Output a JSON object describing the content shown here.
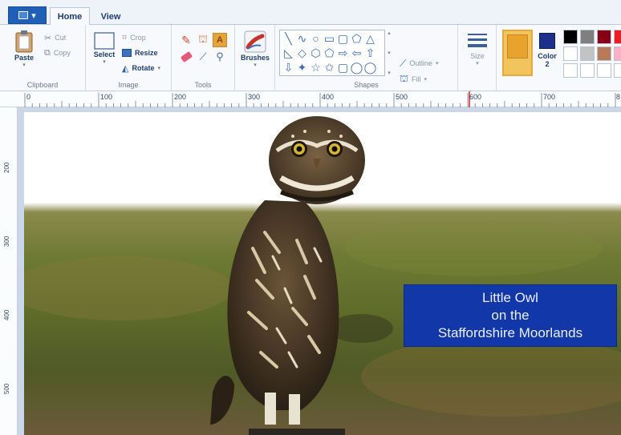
{
  "app_menu": {
    "icon": "paint-menu-icon"
  },
  "tabs": [
    {
      "label": "Home",
      "active": true
    },
    {
      "label": "View",
      "active": false
    }
  ],
  "ribbon": {
    "clipboard": {
      "group_label": "Clipboard",
      "paste_label": "Paste",
      "cut_label": "Cut",
      "copy_label": "Copy"
    },
    "image": {
      "group_label": "Image",
      "select_label": "Select",
      "crop_label": "Crop",
      "resize_label": "Resize",
      "rotate_label": "Rotate"
    },
    "tools": {
      "group_label": "Tools"
    },
    "brushes": {
      "label": "Brushes"
    },
    "shapes": {
      "group_label": "Shapes",
      "outline_label": "Outline",
      "fill_label": "Fill",
      "glyphs": [
        "╲",
        "∿",
        "○",
        "▭",
        "▢",
        "⬠",
        "△",
        "◺",
        "◇",
        "⬡",
        "⬠",
        "⇨",
        "⇦",
        "⇧",
        "⇩",
        "✦",
        "☆",
        "✩",
        "▢",
        "◯",
        "◯"
      ]
    },
    "size": {
      "label": "Size"
    },
    "color1": {
      "color": "#e8a32c"
    },
    "color2": {
      "label": "Color",
      "label_num": "2",
      "color": "#1c2f8a"
    },
    "palette": [
      "#000000",
      "#7f7f7f",
      "#880015",
      "#ed1c24",
      "#ffffff",
      "#c3c3c3",
      "#b97a57",
      "#ffaec9",
      "#ffffff",
      "#ffffff",
      "#ffffff",
      "#ffffff"
    ]
  },
  "ruler": {
    "labels": [
      "0",
      "100",
      "200",
      "300",
      "400",
      "500",
      "600",
      "700",
      "8"
    ],
    "v_labels": [
      "200",
      "300",
      "400",
      "500"
    ]
  },
  "canvas": {
    "caption_lines": [
      "Little Owl",
      "on the",
      "Staffordshire Moorlands"
    ],
    "caption_bg": "#1237a8"
  }
}
